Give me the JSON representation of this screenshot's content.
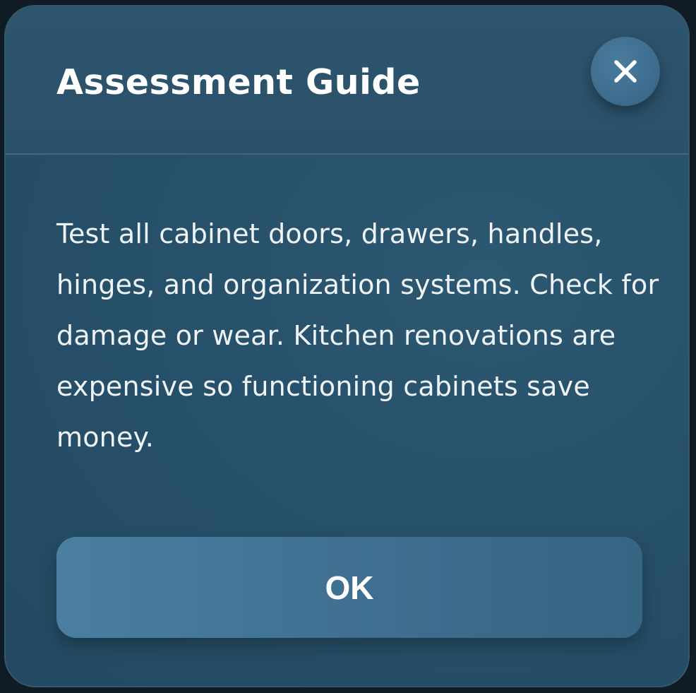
{
  "dialog": {
    "title": "Assessment Guide",
    "close_icon": "close-icon",
    "body": "Test all cabinet doors, drawers, handles, hinges, and organization systems. Check for damage or wear. Kitchen renovations are expensive so functioning cabinets save money.",
    "ok_label": "OK"
  },
  "colors": {
    "background": "#0f1c26",
    "panel": "#27506a",
    "header": "#2c536c",
    "button": "#427496",
    "text": "#ffffff"
  }
}
